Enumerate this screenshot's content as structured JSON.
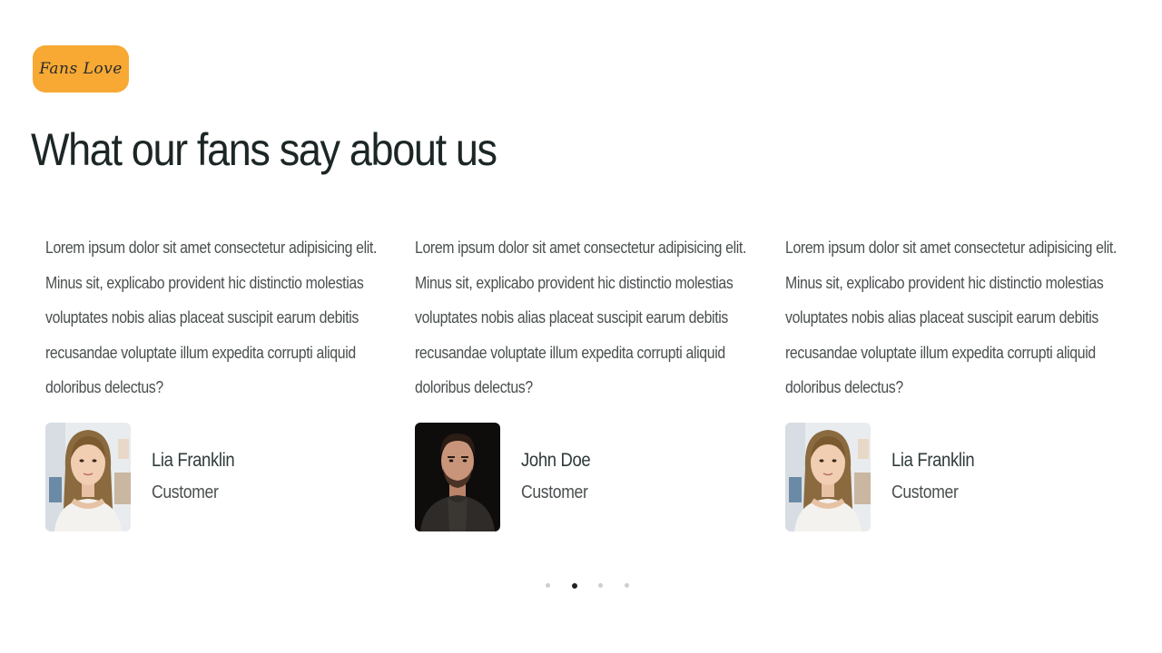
{
  "section": {
    "badge": "Fans Love",
    "title": "What our fans say about us"
  },
  "testimonials": [
    {
      "quote": "Lorem ipsum dolor sit amet consectetur adipisicing elit. Minus sit, explicabo provident hic distinctio molestias voluptates nobis alias placeat suscipit earum debitis recusandae voluptate illum expedita corrupti aliquid doloribus delectus?",
      "name": "Lia Franklin",
      "role": "Customer",
      "avatar": "woman-portrait"
    },
    {
      "quote": "Lorem ipsum dolor sit amet consectetur adipisicing elit. Minus sit, explicabo provident hic distinctio molestias voluptates nobis alias placeat suscipit earum debitis recusandae voluptate illum expedita corrupti aliquid doloribus delectus?",
      "name": "John Doe",
      "role": "Customer",
      "avatar": "man-portrait"
    },
    {
      "quote": "Lorem ipsum dolor sit amet consectetur adipisicing elit. Minus sit, explicabo provident hic distinctio molestias voluptates nobis alias placeat suscipit earum debitis recusandae voluptate illum expedita corrupti aliquid doloribus delectus?",
      "name": "Lia Franklin",
      "role": "Customer",
      "avatar": "woman-portrait"
    }
  ],
  "pagination": {
    "count": 4,
    "active_index": 1
  },
  "colors": {
    "badge_bg": "#f7a934",
    "title": "#1d2626",
    "body_text": "#4a4f4f",
    "dot_active": "#222222",
    "dot_inactive": "#cfcfcf"
  }
}
